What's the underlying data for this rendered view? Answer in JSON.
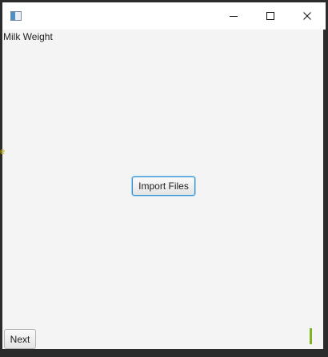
{
  "window": {
    "title_icon": "app-window-icon",
    "controls": {
      "minimize_icon": "minimize-icon",
      "maximize_icon": "maximize-icon",
      "close_icon": "close-icon"
    }
  },
  "main": {
    "title": "Milk Weight",
    "clipped_label": "e",
    "import_button_label": "Import Files",
    "next_button_label": "Next",
    "accent_color": "#7db521",
    "focus_color": "#2f8fd0",
    "clipped_label_color": "#c8b400"
  }
}
